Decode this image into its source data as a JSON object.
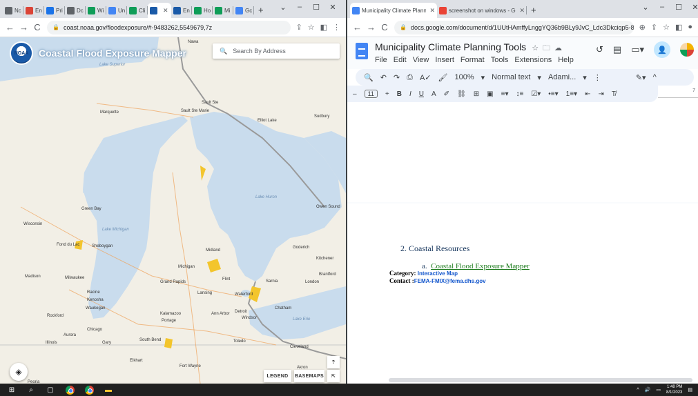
{
  "left_window": {
    "tabs": [
      {
        "label": "Nc",
        "color": "#5f6368"
      },
      {
        "label": "En",
        "color": "#db4437"
      },
      {
        "label": "Pri",
        "color": "#1a73e8"
      },
      {
        "label": "Dc",
        "color": "#5f6368"
      },
      {
        "label": "Wi",
        "color": "#0f9d58"
      },
      {
        "label": "Un",
        "color": "#4285f4"
      },
      {
        "label": "Cli",
        "color": "#0f9d58"
      },
      {
        "label": "",
        "color": "#1a5aa8"
      },
      {
        "label": "En",
        "color": "#1a5aa8"
      },
      {
        "label": "Ho",
        "color": "#0f9d58"
      },
      {
        "label": "Mi",
        "color": "#0f9d58"
      },
      {
        "label": "Gc",
        "color": "#4285f4"
      }
    ],
    "url": "coast.noaa.gov/floodexposure/#-9483262,5549679,7z",
    "map": {
      "title": "Coastal Flood Exposure Mapper",
      "search_placeholder": "Search By Address",
      "legend_label": "LEGEND",
      "basemaps_label": "BASEMAPS",
      "help_label": "?",
      "places": [
        {
          "name": "Lake Superior",
          "water": true
        },
        {
          "name": "Nawa",
          "water": false
        },
        {
          "name": "Marquette",
          "water": false
        },
        {
          "name": "Sault Ste Marie",
          "water": false
        },
        {
          "name": "Sault Ste",
          "water": false
        },
        {
          "name": "Elliot Lake",
          "water": false
        },
        {
          "name": "Sudbury",
          "water": false
        },
        {
          "name": "Lake Huron",
          "water": true
        },
        {
          "name": "Owen Sound",
          "water": false
        },
        {
          "name": "Green Bay",
          "water": false
        },
        {
          "name": "Wisconsin",
          "water": false
        },
        {
          "name": "Lake Michigan",
          "water": true
        },
        {
          "name": "Fond du Lac",
          "water": false
        },
        {
          "name": "Sheboygan",
          "water": false
        },
        {
          "name": "Midland",
          "water": false
        },
        {
          "name": "Goderich",
          "water": false
        },
        {
          "name": "Kitchener",
          "water": false
        },
        {
          "name": "Michigan",
          "water": false
        },
        {
          "name": "Madison",
          "water": false
        },
        {
          "name": "Milwaukee",
          "water": false
        },
        {
          "name": "Grand Rapids",
          "water": false
        },
        {
          "name": "Flint",
          "water": false
        },
        {
          "name": "Sarnia",
          "water": false
        },
        {
          "name": "London",
          "water": false
        },
        {
          "name": "Brantford",
          "water": false
        },
        {
          "name": "Racine",
          "water": false
        },
        {
          "name": "Kenosha",
          "water": false
        },
        {
          "name": "Waukegan",
          "water": false
        },
        {
          "name": "Lansing",
          "water": false
        },
        {
          "name": "Waterford",
          "water": false
        },
        {
          "name": "Rockford",
          "water": false
        },
        {
          "name": "Kalamazoo",
          "water": false
        },
        {
          "name": "Portage",
          "water": false
        },
        {
          "name": "Ann Arbor",
          "water": false
        },
        {
          "name": "Detroit",
          "water": false
        },
        {
          "name": "Windsor",
          "water": false
        },
        {
          "name": "Chatham",
          "water": false
        },
        {
          "name": "Lake Erie",
          "water": true
        },
        {
          "name": "Chicago",
          "water": false
        },
        {
          "name": "Aurora",
          "water": false
        },
        {
          "name": "Illinois",
          "water": false
        },
        {
          "name": "Gary",
          "water": false
        },
        {
          "name": "South Bend",
          "water": false
        },
        {
          "name": "Elkhart",
          "water": false
        },
        {
          "name": "Toledo",
          "water": false
        },
        {
          "name": "Cleveland",
          "water": false
        },
        {
          "name": "Akron",
          "water": false
        },
        {
          "name": "Fort Wayne",
          "water": false
        },
        {
          "name": "Peoria",
          "water": false
        }
      ]
    }
  },
  "right_window": {
    "tabs": [
      {
        "label": "Municipality Climate Planning Too",
        "color": "#4285f4"
      },
      {
        "label": "screenshot on windows - Google",
        "color": "#ea4335"
      }
    ],
    "url": "docs.google.com/document/d/1UUtHAmffyLnggYQ36b9BLy9JvC_Ldc3Dkciqp5-8X8c/edit",
    "doc_title": "Municipality Climate Planning Tools",
    "menus": [
      "File",
      "Edit",
      "View",
      "Insert",
      "Format",
      "Tools",
      "Extensions",
      "Help"
    ],
    "zoom": "100%",
    "style": "Normal text",
    "font": "Adami...",
    "font_size": "11",
    "ruler_mark": "7",
    "content": {
      "heading": "2.  Coastal Resources",
      "sub_prefix": "a.",
      "sub_link": "Coastal Flood Exposure Mapper",
      "category_label": "Category:",
      "category_value": "Interactive Map",
      "contact_label": "Contact :",
      "contact_value": "FEMA-FMIX@fema.dhs.gov"
    }
  },
  "taskbar": {
    "time": "1:48 PM",
    "date": "8/1/2023"
  }
}
